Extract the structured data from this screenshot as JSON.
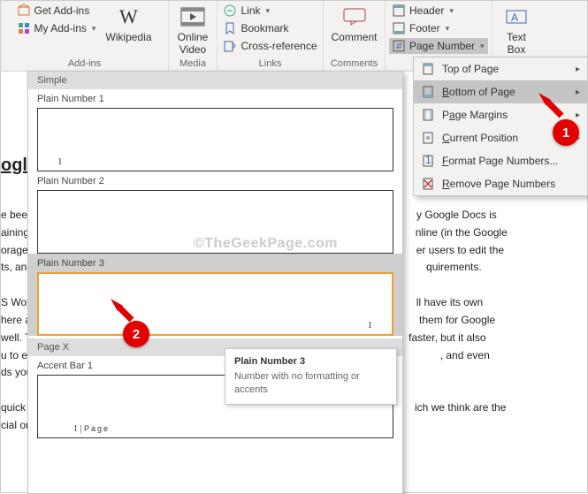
{
  "ribbon": {
    "addins": {
      "get": "Get Add-ins",
      "my": "My Add-ins",
      "wiki": "Wikipedia",
      "group": "Add-ins"
    },
    "media": {
      "video": "Online\nVideo",
      "group": "Media"
    },
    "links": {
      "link": "Link",
      "bookmark": "Bookmark",
      "xref": "Cross-reference",
      "group": "Links"
    },
    "comments": {
      "comment": "Comment",
      "group": "Comments"
    },
    "hf": {
      "header": "Header",
      "footer": "Footer",
      "pagenum": "Page Number"
    },
    "text": {
      "box": "Text\nBox"
    }
  },
  "dropdown": {
    "top": "Top of Page",
    "bottom": "Bottom of Page",
    "margins": "Page Margins",
    "current": "Current Position",
    "format": "Format Page Numbers...",
    "remove": "Remove Page Numbers"
  },
  "gallery": {
    "section1": "Simple",
    "i1": "Plain Number 1",
    "i2": "Plain Number 2",
    "i3": "Plain Number 3",
    "section2": "Page X",
    "i4": "Accent Bar 1",
    "accent_label": "Page"
  },
  "tooltip": {
    "title": "Plain Number 3",
    "body": "Number with no formatting or accents"
  },
  "doc": {
    "heading": "ogle D",
    "p1a": "e been ",
    "p1b": "y Google Docs is",
    "p2a": "aining t",
    "p2b": "nline (in the Google",
    "p3a": "orage) a",
    "p3b": "er users to edit the",
    "p4a": "ts, and",
    "p4b": "quirements.",
    "p5a": "S Word",
    "p5b": "ll have its own",
    "p6a": "here ar",
    "p6b": "them for Google",
    "p7a": "well. Th",
    "p7b": "faster, but it also",
    "p8a": "u to en",
    "p8b": ", and even",
    "p9a": "ds you",
    "p10a": "quick",
    "p10b": "ich we think are the",
    "p11a": "cial on"
  },
  "markers": {
    "m1": "1",
    "m2": "2"
  },
  "watermark": "©TheGeekPage.com"
}
